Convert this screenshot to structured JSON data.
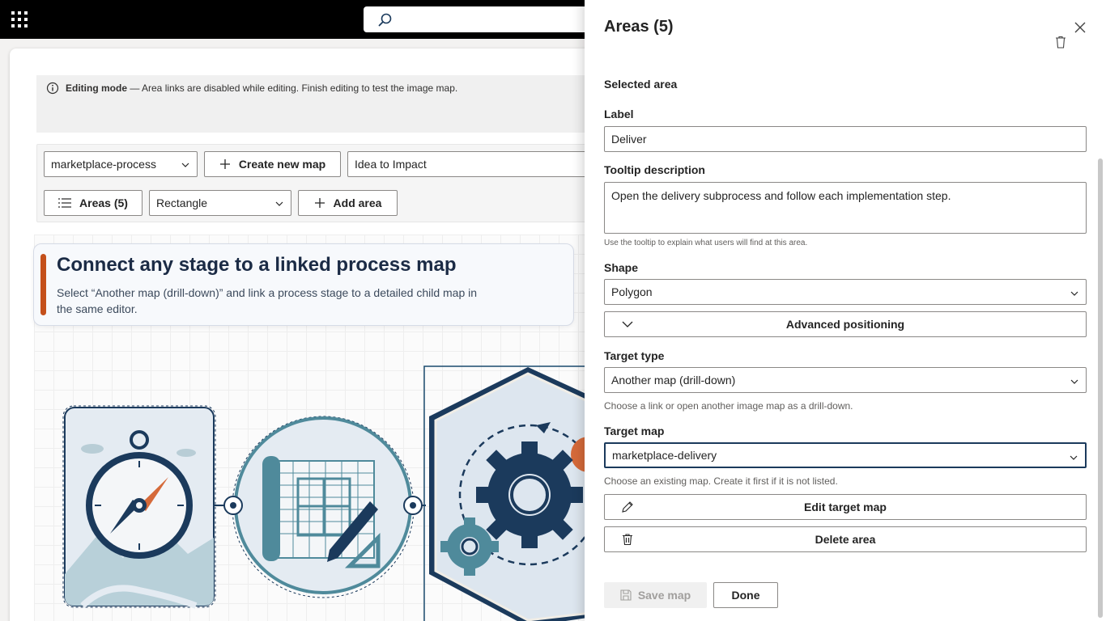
{
  "topbar": {
    "app_launcher_icon": "waffle-icon",
    "search_icon": "search-icon"
  },
  "banner": {
    "mode_label": "Editing mode",
    "message": " — Area links are disabled while editing. Finish editing to test the image map."
  },
  "toolbar": {
    "map_select_value": "marketplace-process",
    "create_map_label": "Create new map",
    "map_title_value": "Idea to Impact",
    "areas_label": "Areas (5)",
    "shape_select_value": "Rectangle",
    "add_area_label": "Add area"
  },
  "hero": {
    "title": "Connect any stage to a linked process map",
    "subtitle": "Select “Another map (drill-down)” and link a process stage to a detailed child map in the same editor."
  },
  "panel": {
    "title": "Areas (5)",
    "selected_area_heading": "Selected area",
    "label_heading": "Label",
    "label_value": "Deliver",
    "tooltip_heading": "Tooltip description",
    "tooltip_value": "Open the delivery subprocess and follow each implementation step.",
    "tooltip_hint": "Use the tooltip to explain what users will find at this area.",
    "shape_heading": "Shape",
    "shape_value": "Polygon",
    "advanced_positioning_label": "Advanced positioning",
    "target_type_heading": "Target type",
    "target_type_value": "Another map (drill-down)",
    "target_type_hint": "Choose a link or open another image map as a drill-down.",
    "target_map_heading": "Target map",
    "target_map_value": "marketplace-delivery",
    "target_map_hint": "Choose an existing map. Create it first if it is not listed.",
    "edit_target_map_label": "Edit target map",
    "delete_area_label": "Delete area",
    "save_map_label": "Save map",
    "done_label": "Done"
  },
  "colors": {
    "accent": "#c4501b",
    "navy": "#1b3a5c",
    "teal": "#4f8a9b"
  }
}
